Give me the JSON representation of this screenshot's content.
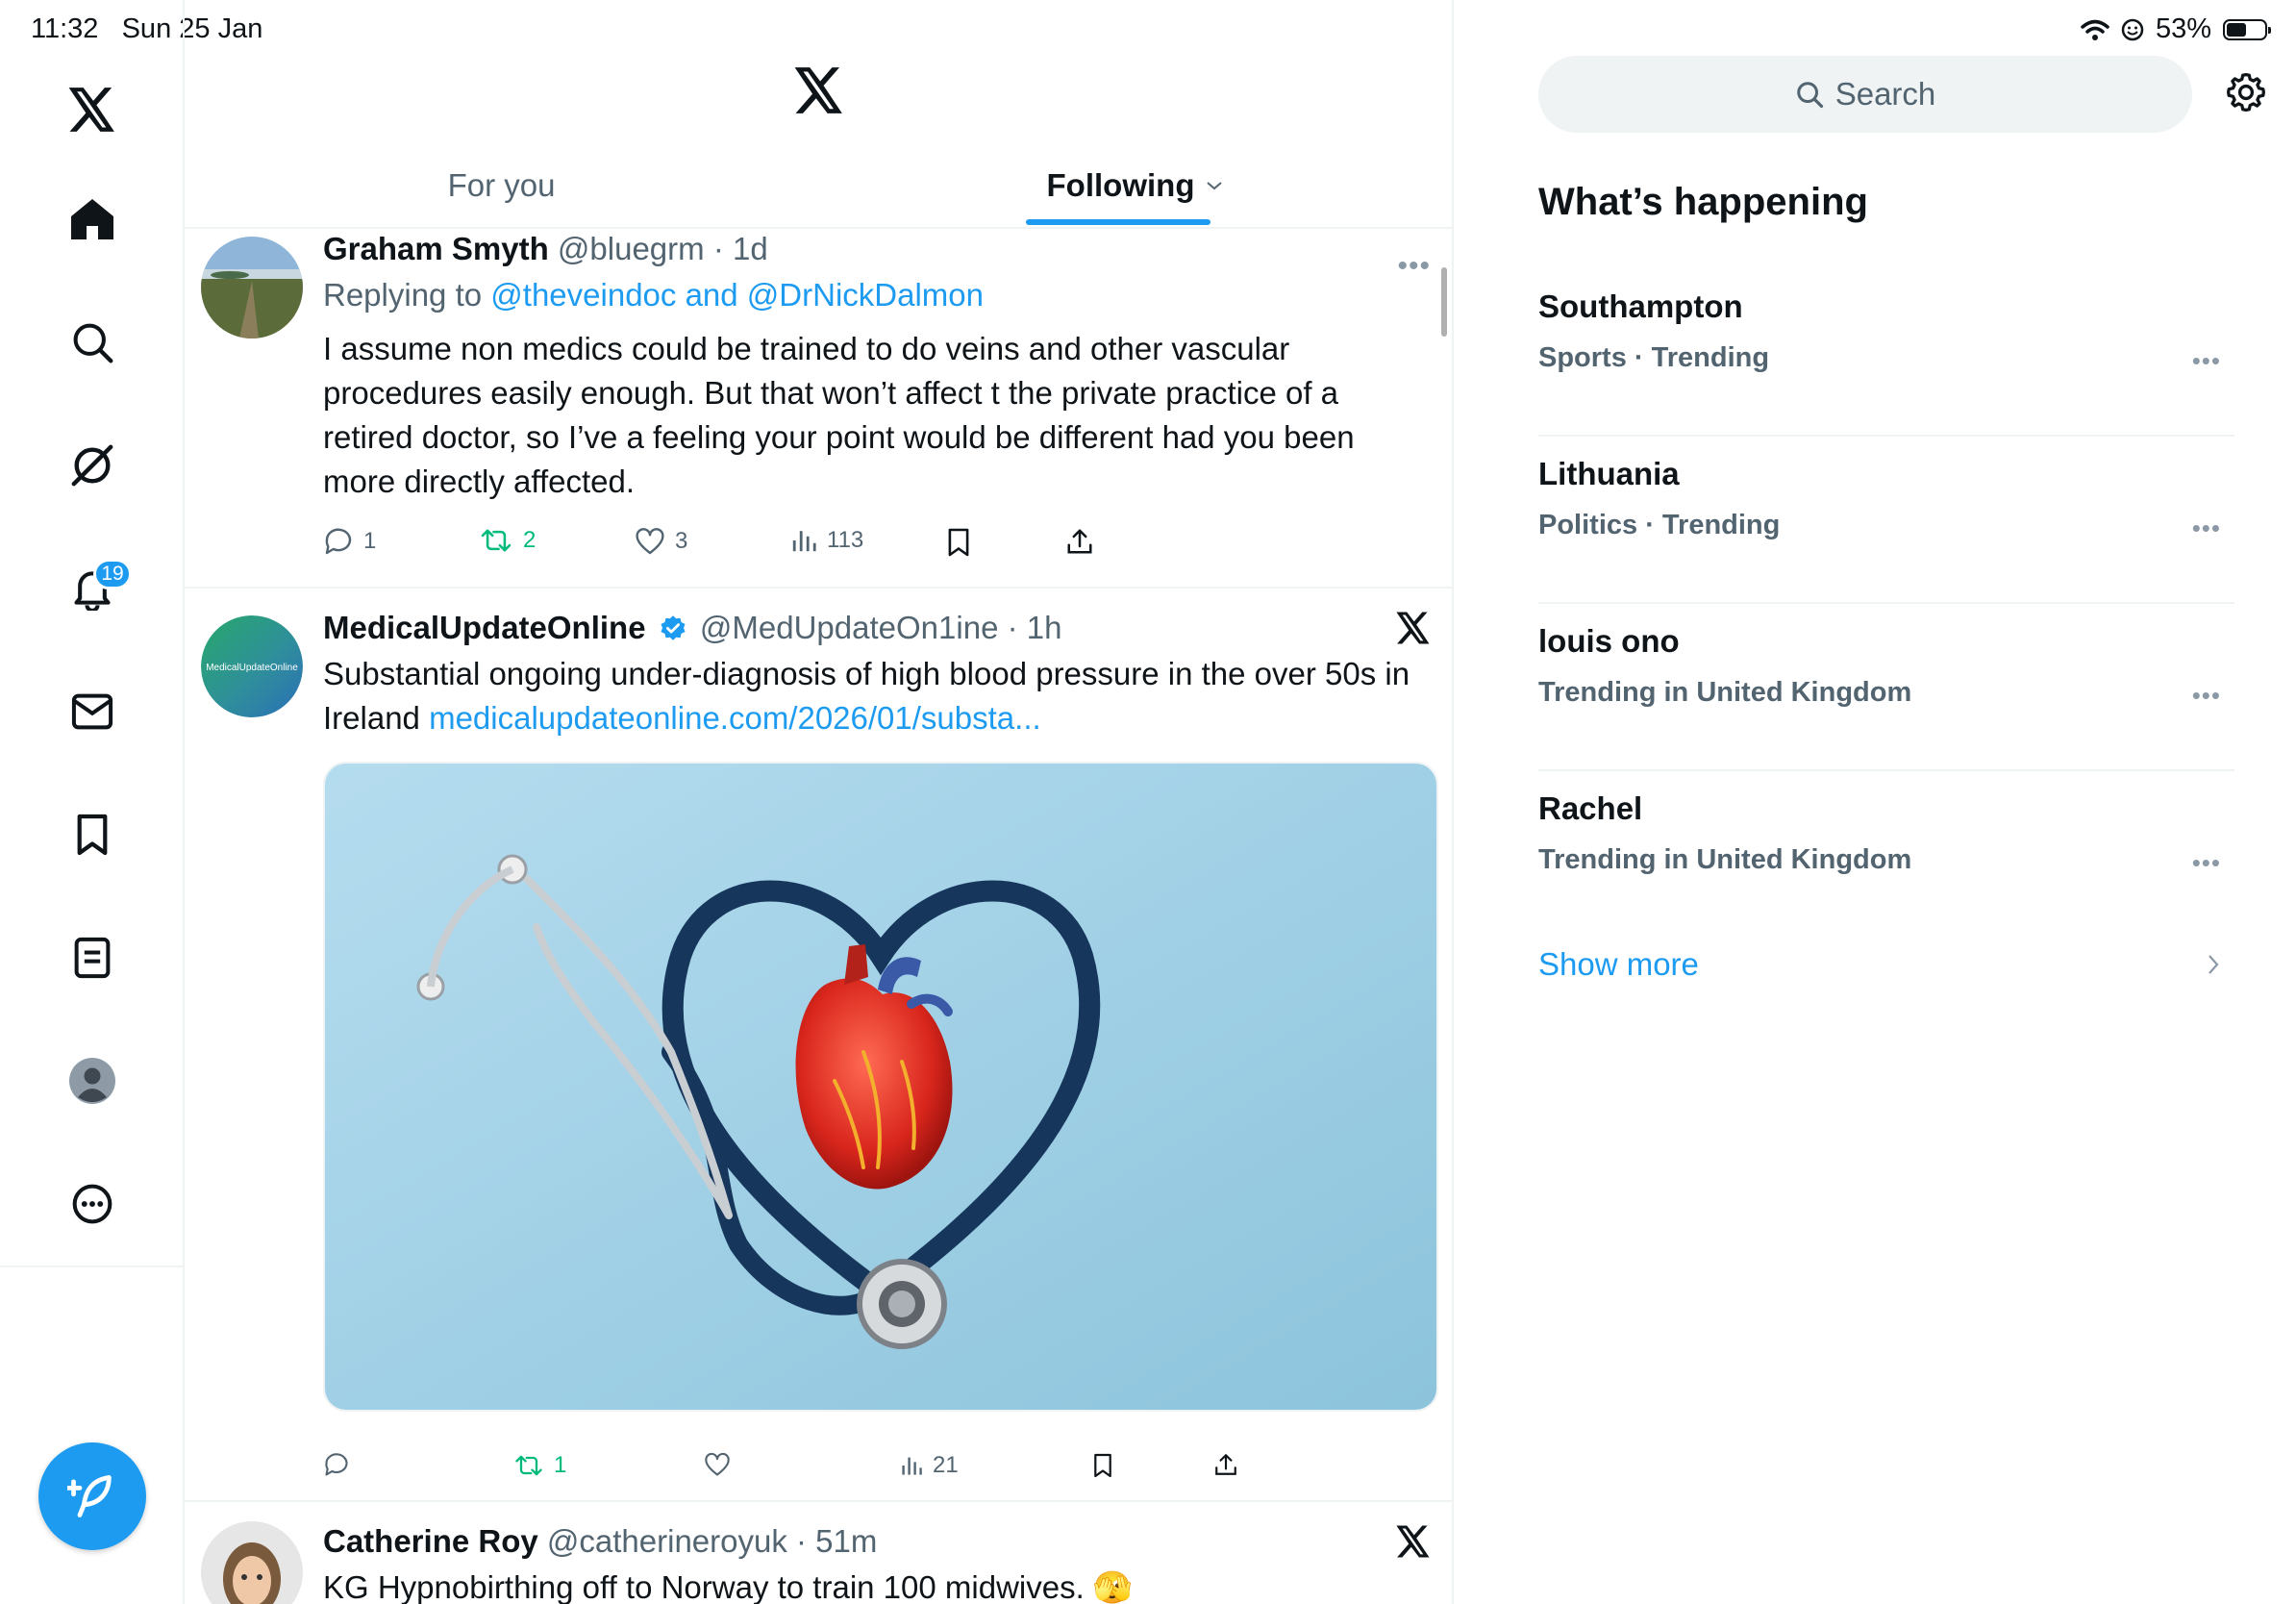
{
  "status_bar": {
    "time": "11:32",
    "date": "Sun 25 Jan",
    "battery": "53%",
    "battery_level": 0.53
  },
  "nav": {
    "items": [
      "x-logo",
      "home",
      "explore",
      "grok",
      "notifications",
      "messages",
      "bookmarks",
      "lists",
      "profile",
      "more"
    ],
    "notifications_badge": "19"
  },
  "header": {
    "tabs": [
      {
        "label": "For you",
        "active": false
      },
      {
        "label": "Following",
        "active": true
      }
    ]
  },
  "feed": [
    {
      "name": "Graham Smyth",
      "handle": "@bluegrm",
      "time": "· 1d",
      "reply_prefix": "Replying to",
      "reply_to": "@theveindoc and @DrNickDalmon",
      "text": "I assume non medics could be trained to do veins and other vascular procedures easily enough. But that won’t affect t the private practice of a retired doctor, so I’ve a feeling your point would be different had you been more directly affected.",
      "replies": "1",
      "reposts": "2",
      "likes": "3",
      "views": "113"
    },
    {
      "name": "MedicalUpdateOnline",
      "avatar_text": "MedicalUpdateOnline",
      "handle": "@MedUpdateOn1ine",
      "time": "· 1h",
      "text": "Substantial ongoing under-diagnosis of high blood pressure in the over 50s in Ireland",
      "link": "medicalupdateonline.com/2026/01/substa...",
      "replies": "",
      "reposts": "1",
      "likes": "",
      "views": "21"
    },
    {
      "name": "Catherine Roy",
      "handle": "@catherineroyuk",
      "time": "· 51m",
      "text": "KG Hypnobirthing off to Norway to train 100 midwives. 🫣"
    }
  ],
  "sidebar": {
    "search_placeholder": "Search",
    "heading": "What’s happening",
    "trends": [
      {
        "name": "Southampton",
        "category": "Sports · Trending"
      },
      {
        "name": "Lithuania",
        "category": "Politics · Trending"
      },
      {
        "name": "louis ono",
        "category": "Trending in United Kingdom"
      },
      {
        "name": "Rachel",
        "category": "Trending in United Kingdom"
      }
    ],
    "show_more": "Show more"
  },
  "colors": {
    "accent": "#1d9bf0",
    "repost_green": "#00ba7c",
    "secondary_text": "#536471",
    "divider": "#eff3f4"
  }
}
